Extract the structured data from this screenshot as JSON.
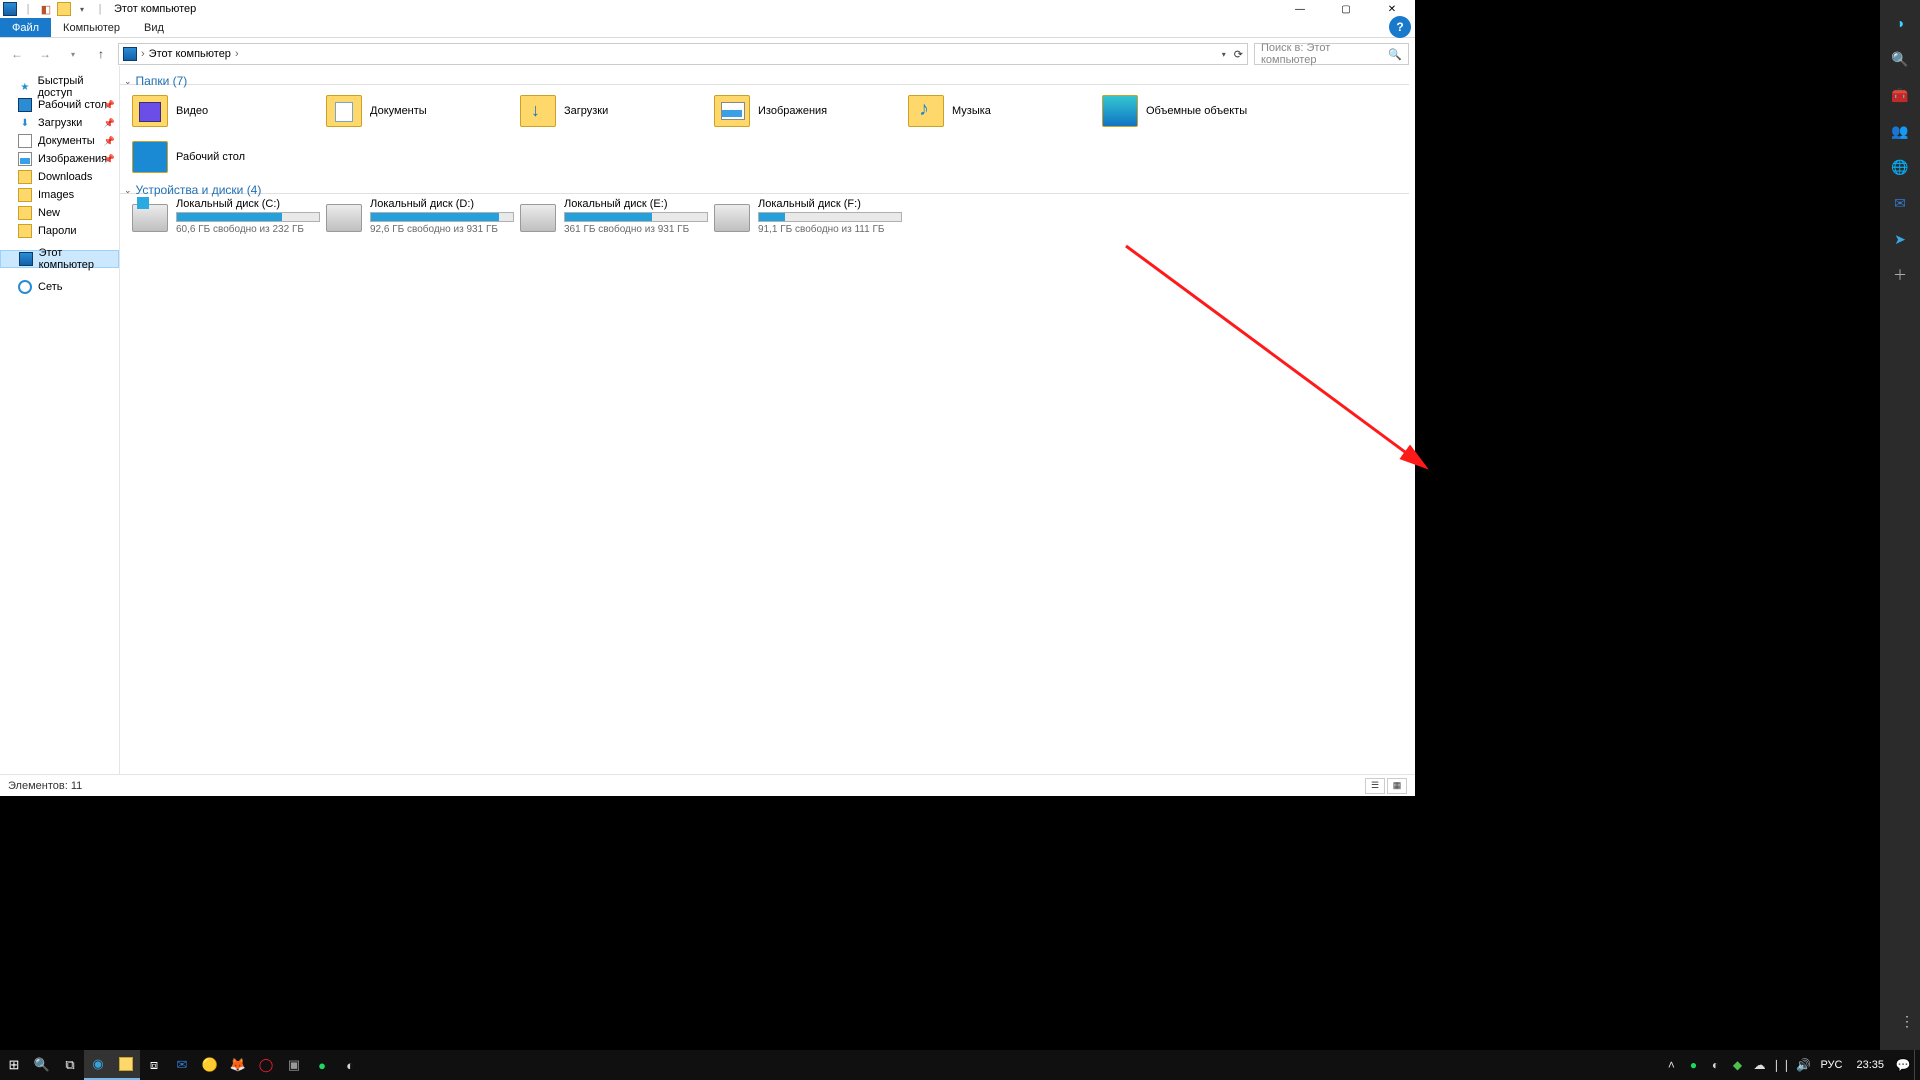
{
  "window": {
    "title": "Этот компьютер"
  },
  "ribbon": {
    "file": "Файл",
    "computer": "Компьютер",
    "view": "Вид"
  },
  "addressbar": {
    "crumb": "Этот компьютер",
    "sep": "›"
  },
  "search": {
    "placeholder": "Поиск в: Этот компьютер"
  },
  "sidebar": {
    "quick": "Быстрый доступ",
    "desktop": "Рабочий стол",
    "downloads": "Загрузки",
    "documents": "Документы",
    "pictures": "Изображения",
    "dlfolder": "Downloads",
    "images": "Images",
    "new": "New",
    "passwords": "Пароли",
    "thispc": "Этот компьютер",
    "network": "Сеть"
  },
  "groups": {
    "folders": "Папки (7)",
    "drives": "Устройства и диски (4)"
  },
  "folders": {
    "video": "Видео",
    "documents": "Документы",
    "downloads": "Загрузки",
    "pictures": "Изображения",
    "music": "Музыка",
    "objects3d": "Объемные объекты",
    "desktop": "Рабочий стол"
  },
  "drives": [
    {
      "label": "Локальный диск (C:)",
      "free": "60,6 ГБ свободно из 232 ГБ",
      "pct": 74
    },
    {
      "label": "Локальный диск (D:)",
      "free": "92,6 ГБ свободно из 931 ГБ",
      "pct": 90
    },
    {
      "label": "Локальный диск (E:)",
      "free": "361 ГБ свободно из 931 ГБ",
      "pct": 61
    },
    {
      "label": "Локальный диск (F:)",
      "free": "91,1 ГБ свободно из 111 ГБ",
      "pct": 18
    }
  ],
  "status": {
    "items": "Элементов: 11"
  },
  "taskbar": {
    "lang": "РУС",
    "time": "23:35"
  }
}
